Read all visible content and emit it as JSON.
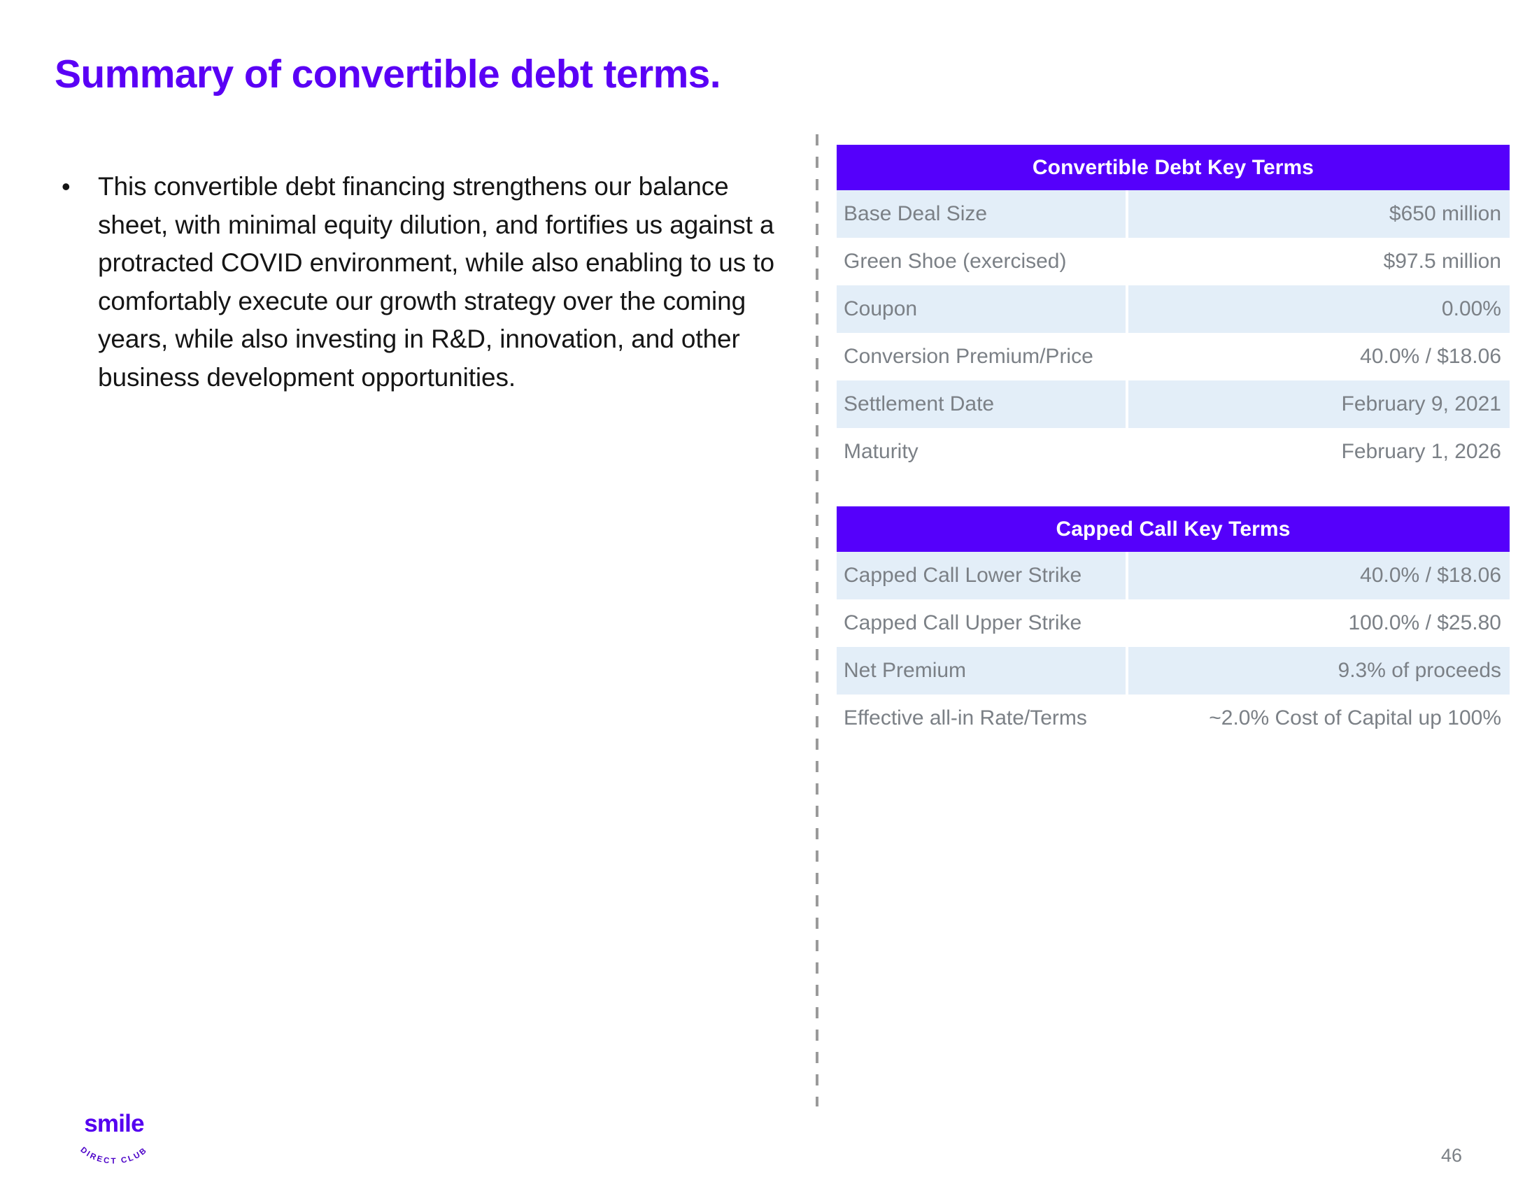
{
  "slide": {
    "title": "Summary of convertible debt terms.",
    "page_number": "46",
    "accent_purple": "#5500fb",
    "title_purple": "#5a00f5",
    "row_shade": "#e3eef8",
    "body_gray": "#7b8086"
  },
  "bullets": [
    {
      "marker": "•",
      "text": "This convertible debt financing strengthens our balance sheet, with minimal equity dilution, and fortifies us against a protracted COVID environment, while also enabling to us to comfortably execute our growth strategy over the coming years, while also investing in R&D, innovation, and other business development opportunities."
    }
  ],
  "tables": [
    {
      "id": "convertible",
      "header": "Convertible Debt Key Terms",
      "rows": [
        {
          "label": "Base Deal Size",
          "value": "$650 million",
          "shaded": true
        },
        {
          "label": "Green Shoe (exercised)",
          "value": "$97.5 million",
          "shaded": false
        },
        {
          "label": "Coupon",
          "value": "0.00%",
          "shaded": true
        },
        {
          "label": "Conversion Premium/Price",
          "value": "40.0% / $18.06",
          "shaded": false
        },
        {
          "label": "Settlement Date",
          "value": "February 9, 2021",
          "shaded": true
        },
        {
          "label": "Maturity",
          "value": "February 1, 2026",
          "shaded": false
        }
      ]
    },
    {
      "id": "cappedcall",
      "header": "Capped Call Key Terms",
      "rows": [
        {
          "label": "Capped Call Lower Strike",
          "value": "40.0% / $18.06",
          "shaded": true
        },
        {
          "label": "Capped Call Upper Strike",
          "value": "100.0% / $25.80",
          "shaded": false
        },
        {
          "label": "Net Premium",
          "value": "9.3% of proceeds",
          "shaded": true
        },
        {
          "label": "Effective all-in Rate/Terms",
          "value": "~2.0% Cost of Capital up 100%",
          "shaded": false
        }
      ]
    }
  ],
  "logo": {
    "wordmark": "smile",
    "arc_text": "DIRECT CLUB"
  }
}
